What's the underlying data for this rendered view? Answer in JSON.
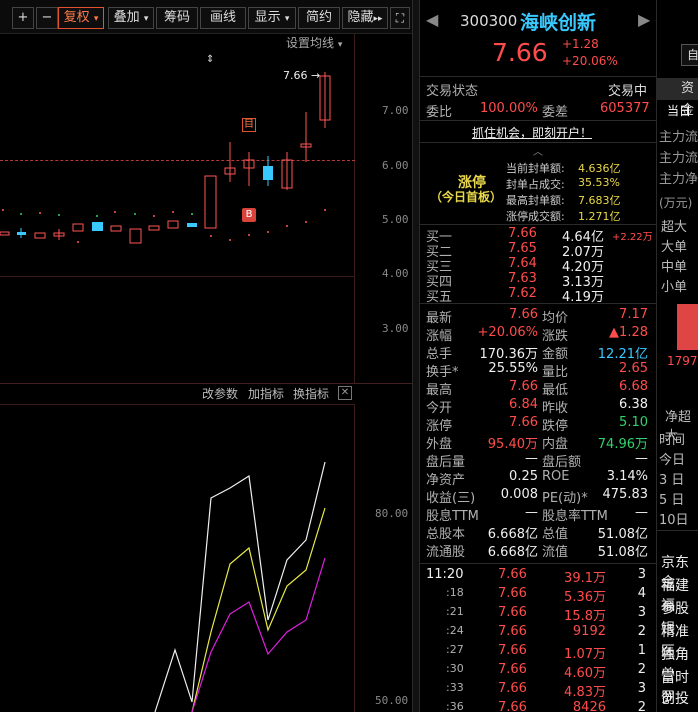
{
  "toolbar": {
    "plus": "+",
    "minus": "−",
    "fq": "复权",
    "overlay": "叠加",
    "chips": "筹码",
    "draw": "画线",
    "display": "显示",
    "simple": "简约",
    "hide": "隐藏"
  },
  "chart": {
    "ma_settings": "设置均线",
    "price_marker": "7.66",
    "y_labels": [
      "7.00",
      "6.00",
      "5.00",
      "4.00",
      "3.00"
    ],
    "badge_top": "目",
    "badge_bottom": "B",
    "indicator_buttons": {
      "params": "改参数",
      "add": "加指标",
      "switch": "换指标"
    },
    "ind_y_labels": [
      "80.00",
      "50.00"
    ]
  },
  "stock": {
    "code": "300300",
    "name": "海峡创新",
    "price": "7.66",
    "change": "+1.28",
    "change_pct": "+20.06%"
  },
  "trade_status": {
    "label": "交易状态",
    "value": "交易中"
  },
  "ratio": {
    "wb_label": "委比",
    "wb": "100.00%",
    "wc_label": "委差",
    "wc": "605377"
  },
  "promo": "抓住机会，即刻开户！",
  "limit": {
    "title1": "涨停",
    "title2": "（今日首板）",
    "rows": [
      {
        "k": "当前封单额:",
        "v": "4.636亿"
      },
      {
        "k": "封单占成交:",
        "v": "35.53%"
      },
      {
        "k": "最高封单额:",
        "v": "7.683亿"
      },
      {
        "k": "涨停成交额:",
        "v": "1.271亿"
      }
    ]
  },
  "orderbook": [
    {
      "k": "买一",
      "p": "7.66",
      "v": "4.64亿",
      "d": "+2.22万"
    },
    {
      "k": "买二",
      "p": "7.65",
      "v": "2.07万",
      "d": ""
    },
    {
      "k": "买三",
      "p": "7.64",
      "v": "4.20万",
      "d": ""
    },
    {
      "k": "买四",
      "p": "7.63",
      "v": "3.13万",
      "d": ""
    },
    {
      "k": "买五",
      "p": "7.62",
      "v": "4.19万",
      "d": ""
    }
  ],
  "stats": [
    {
      "k1": "最新",
      "v1": "7.66",
      "c1": "red",
      "k2": "均价",
      "v2": "7.17",
      "c2": "red"
    },
    {
      "k1": "涨幅",
      "v1": "+20.06%",
      "c1": "red",
      "k2": "涨跌",
      "v2": "▲1.28",
      "c2": "red"
    },
    {
      "k1": "总手",
      "v1": "170.36万",
      "c1": "white",
      "k2": "金额",
      "v2": "12.21亿",
      "c2": "cyan"
    },
    {
      "k1": "换手*",
      "v1": "25.55%",
      "c1": "white",
      "k2": "量比",
      "v2": "2.65",
      "c2": "red"
    },
    {
      "k1": "最高",
      "v1": "7.66",
      "c1": "red",
      "k2": "最低",
      "v2": "6.68",
      "c2": "red"
    },
    {
      "k1": "今开",
      "v1": "6.84",
      "c1": "red",
      "k2": "昨收",
      "v2": "6.38",
      "c2": "white"
    },
    {
      "k1": "涨停",
      "v1": "7.66",
      "c1": "red",
      "k2": "跌停",
      "v2": "5.10",
      "c2": "green"
    },
    {
      "k1": "外盘",
      "v1": "95.40万",
      "c1": "red",
      "k2": "内盘",
      "v2": "74.96万",
      "c2": "green"
    },
    {
      "k1": "盘后量",
      "v1": "—",
      "c1": "white",
      "k2": "盘后额",
      "v2": "—",
      "c2": "white"
    },
    {
      "k1": "净资产",
      "v1": "0.25",
      "c1": "white",
      "k2": "ROE",
      "v2": "3.14%",
      "c2": "white"
    },
    {
      "k1": "收益(三)",
      "v1": "0.008",
      "c1": "white",
      "k2": "PE(动)*",
      "v2": "475.83",
      "c2": "white"
    },
    {
      "k1": "股息TTM",
      "v1": "—",
      "c1": "white",
      "k2": "股息率TTM",
      "v2": "—",
      "c2": "white"
    },
    {
      "k1": "总股本",
      "v1": "6.668亿",
      "c1": "white",
      "k2": "总值",
      "v2": "51.08亿",
      "c2": "white"
    },
    {
      "k1": "流通股",
      "v1": "6.668亿",
      "c1": "white",
      "k2": "流值",
      "v2": "51.08亿",
      "c2": "white"
    }
  ],
  "ticks": [
    {
      "t": "11:20",
      "p": "7.66",
      "v": "39.1万",
      "n": "3"
    },
    {
      "t": ":18",
      "p": "7.66",
      "v": "5.36万",
      "n": "4"
    },
    {
      "t": ":21",
      "p": "7.66",
      "v": "15.8万",
      "n": "3"
    },
    {
      "t": ":24",
      "p": "7.66",
      "v": "9192",
      "n": "2"
    },
    {
      "t": ":27",
      "p": "7.66",
      "v": "1.07万",
      "n": "1"
    },
    {
      "t": ":30",
      "p": "7.66",
      "v": "4.60万",
      "n": "2"
    },
    {
      "t": ":33",
      "p": "7.66",
      "v": "4.83万",
      "n": "3"
    },
    {
      "t": ":36",
      "p": "7.66",
      "v": "8426",
      "n": "2"
    }
  ],
  "right_panel": {
    "self": "自",
    "tab_fund": "资金",
    "tab_today": "当日",
    "flow_labels": [
      "主力流",
      "主力流",
      "主力净"
    ],
    "wan": "(万元)",
    "sizes": [
      "超大",
      "大单",
      "中单",
      "小单"
    ],
    "bar_value": "1797",
    "net_label": "净超大",
    "time_labels": [
      "时间",
      "今日",
      "3 日",
      "5 日",
      "10日"
    ],
    "news": [
      "京东金",
      "福建福",
      "参股银",
      "精准医",
      "独角兽",
      "富时罗",
      "创投"
    ]
  }
}
